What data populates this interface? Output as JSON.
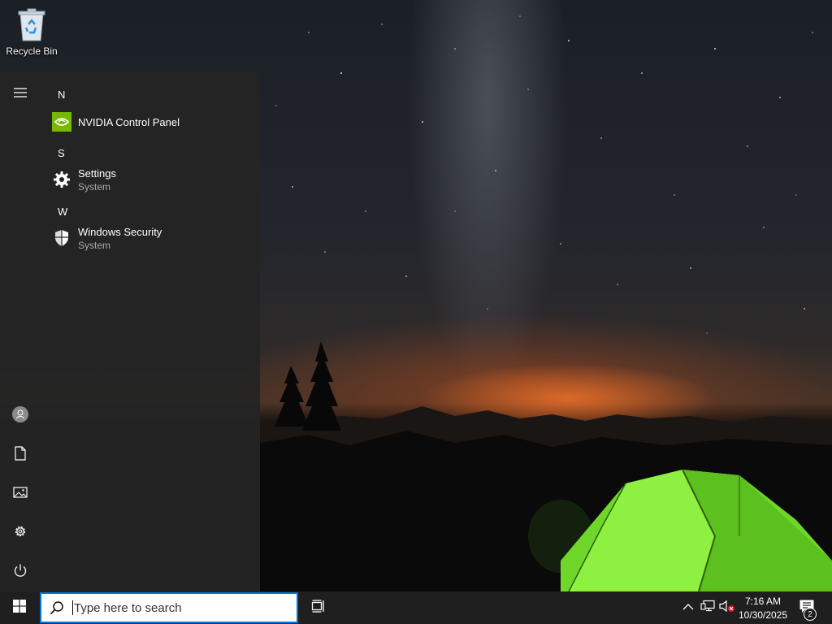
{
  "desktop": {
    "icons": [
      {
        "label": "Recycle Bin",
        "icon": "recycle-bin-icon"
      }
    ]
  },
  "start_menu": {
    "rail": {
      "menu_icon": "hamburger-icon",
      "account_icon": "user-account-icon",
      "documents_icon": "document-icon",
      "pictures_icon": "pictures-icon",
      "settings_icon": "gear-icon",
      "power_icon": "power-icon"
    },
    "groups": [
      {
        "letter": "N",
        "apps": [
          {
            "name": "NVIDIA Control Panel",
            "subtitle": "",
            "icon": "nvidia-icon"
          }
        ]
      },
      {
        "letter": "S",
        "apps": [
          {
            "name": "Settings",
            "subtitle": "System",
            "icon": "gear-icon"
          }
        ]
      },
      {
        "letter": "W",
        "apps": [
          {
            "name": "Windows Security",
            "subtitle": "System",
            "icon": "shield-icon"
          }
        ]
      }
    ]
  },
  "taskbar": {
    "start_icon": "windows-logo-icon",
    "search": {
      "placeholder": "Type here to search",
      "value": ""
    },
    "task_view_icon": "task-view-icon",
    "tray": {
      "chevron_icon": "chevron-up-icon",
      "network_icon": "network-icon",
      "volume_icon": "volume-muted-icon",
      "time": "7:16 AM",
      "date": "10/30/2025",
      "notifications_icon": "notification-icon",
      "notification_count": "2"
    }
  },
  "colors": {
    "accent": "#0078d7",
    "nvidia_green": "#76b900",
    "taskbar_bg": "#1f1f1f",
    "start_bg": "#242424",
    "mute_red": "#e81123"
  }
}
